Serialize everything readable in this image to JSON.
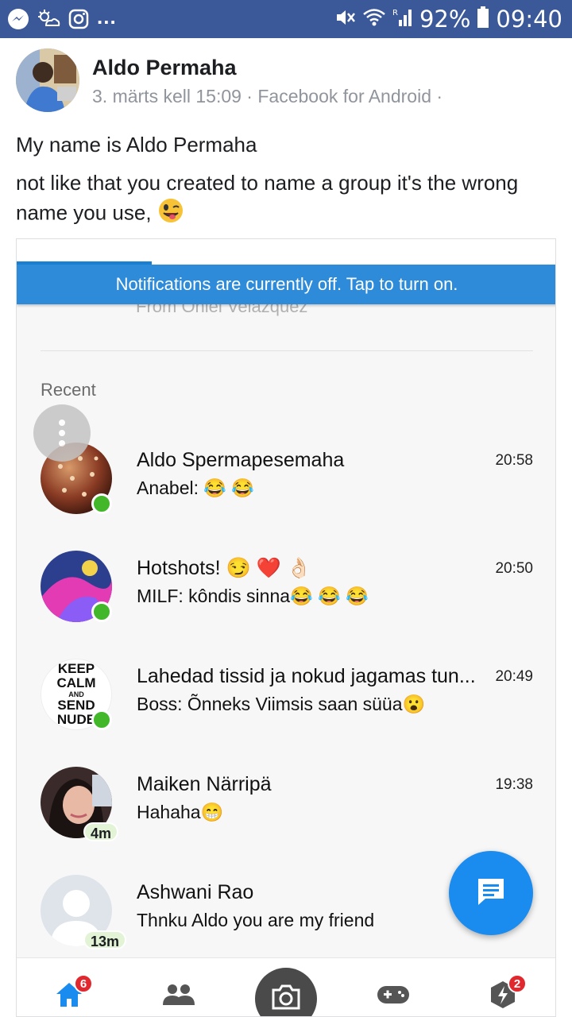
{
  "status_bar": {
    "battery": "92%",
    "time": "09:40",
    "left_icons": [
      "messenger-icon",
      "weather-icon",
      "instagram-icon"
    ],
    "overflow": "...",
    "right_icons": [
      "mute-icon",
      "wifi-icon",
      "signal-icon",
      "battery-icon"
    ],
    "background": "#3b5998"
  },
  "post": {
    "author": "Aldo Permaha",
    "meta": "3. märts kell 15:09 · Facebook for Android ·",
    "line1": "My name is Aldo Permaha",
    "line2": "not like that you created to name a group it's the wrong",
    "line3": "name you use,",
    "line3_emoji": "winking-face-with-tongue"
  },
  "screenshot": {
    "notification_banner": "Notifications are currently off. Tap to turn on.",
    "ghost_text": "From Oniel Velazquez",
    "section_label": "Recent",
    "conversations": [
      {
        "name": "Aldo Spermapesemaha",
        "message": "Anabel: 😂 😂",
        "time": "20:58",
        "presence": "online"
      },
      {
        "name": "Hotshots! 😏 ❤️ 👌🏻",
        "message": "MILF: kôndis sinna😂 😂 😂",
        "time": "20:50",
        "presence": "online"
      },
      {
        "name": "Lahedad tissid ja nokud jagamas tun...",
        "message": "Boss: Õnneks Viimsis saan süüa😮",
        "time": "20:49",
        "presence": "online",
        "avatar_text": [
          "KEEP",
          "CALM",
          "AND",
          "SEND",
          "NUDE"
        ]
      },
      {
        "name": "Maiken Närripä",
        "message": "Hahaha😁",
        "time": "19:38",
        "presence": "4m"
      },
      {
        "name": "Ashwani Rao",
        "message": "Thnku Aldo you are my friend",
        "time": "",
        "presence": "13m"
      }
    ],
    "tabs": [
      {
        "name": "home",
        "badge": "6"
      },
      {
        "name": "people",
        "badge": ""
      },
      {
        "name": "camera",
        "badge": ""
      },
      {
        "name": "games",
        "badge": ""
      },
      {
        "name": "discover",
        "badge": "2"
      }
    ],
    "accent": "#1a8cf0"
  }
}
